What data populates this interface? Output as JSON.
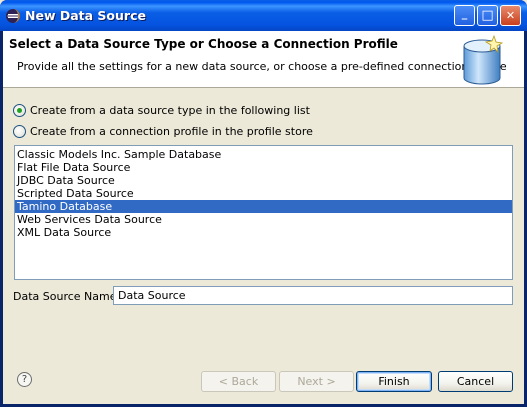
{
  "window": {
    "title": "New Data Source",
    "controls": {
      "minimize": "_",
      "maximize": "□",
      "close": "✕"
    }
  },
  "banner": {
    "title": "Select a Data Source Type or Choose a Connection Profile",
    "description": "Provide all the settings for a new data source, or choose a pre-defined connection profile",
    "icon": "database-icon"
  },
  "options": {
    "from_type": {
      "label": "Create from a data source type in the following list",
      "checked": true
    },
    "from_profile": {
      "label": "Create from a connection profile in the profile store",
      "checked": false
    }
  },
  "source_types": {
    "items": [
      "Classic Models Inc. Sample Database",
      "Flat File Data Source",
      "JDBC Data Source",
      "Scripted Data Source",
      "Tamino Database",
      "Web Services Data Source",
      "XML Data Source"
    ],
    "selected": "Tamino Database"
  },
  "name_field": {
    "label": "Data Source Name:",
    "value": "Data Source"
  },
  "footer": {
    "help_glyph": "?",
    "back_label": "< Back",
    "next_label": "Next >",
    "finish_label": "Finish",
    "cancel_label": "Cancel"
  },
  "colors": {
    "selection": "#316ac5",
    "dialog_bg": "#ece9d8",
    "titlebar": "#0a5fe6"
  }
}
